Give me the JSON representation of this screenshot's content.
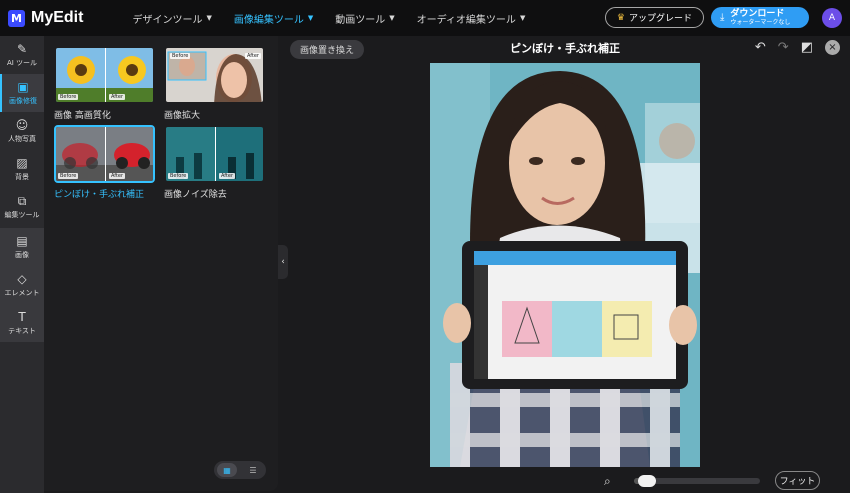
{
  "app": {
    "logo_letter": "M",
    "name": "MyEdit"
  },
  "nav": [
    {
      "label": "デザインツール",
      "active": false
    },
    {
      "label": "画像編集ツール",
      "active": true
    },
    {
      "label": "動画ツール",
      "active": false
    },
    {
      "label": "オーディオ編集ツール",
      "active": false
    }
  ],
  "header": {
    "upgrade_label": "アップグレード",
    "download_label": "ダウンロード",
    "download_sub": "ウォーターマークなし",
    "avatar_initial": "A"
  },
  "sidebar": {
    "items": [
      {
        "label": "AI ツール",
        "icon": "magic-wand-icon",
        "glyph": "✎"
      },
      {
        "label": "画像修復",
        "icon": "image-repair-icon",
        "glyph": "▣",
        "active": true
      },
      {
        "label": "人物写真",
        "icon": "portrait-icon",
        "glyph": "☺"
      },
      {
        "label": "背景",
        "icon": "background-icon",
        "glyph": "▨"
      },
      {
        "label": "編集ツール",
        "icon": "crop-icon",
        "glyph": "⧉"
      }
    ],
    "group_items": [
      {
        "label": "画像",
        "icon": "image-icon",
        "glyph": "▤"
      },
      {
        "label": "エレメント",
        "icon": "elements-icon",
        "glyph": "◇"
      },
      {
        "label": "テキスト",
        "icon": "text-icon",
        "glyph": "T"
      }
    ]
  },
  "tools": [
    {
      "label": "画像 高画質化",
      "before": "Before",
      "after": "After"
    },
    {
      "label": "画像拡大",
      "before": "Before",
      "after": "After"
    },
    {
      "label": "ピンぼけ・手ぶれ補正",
      "before": "Before",
      "after": "After",
      "selected": true
    },
    {
      "label": "画像ノイズ除去",
      "before": "Before",
      "after": "After"
    }
  ],
  "canvas": {
    "replace_label": "画像置き換え",
    "title": "ピンぼけ・手ぶれ補正",
    "fit_label": "フィット",
    "zoom_fraction": 0.04
  },
  "colors": {
    "accent": "#35c2ff",
    "download": "#2f9df4",
    "avatar": "#6c4ee8"
  }
}
